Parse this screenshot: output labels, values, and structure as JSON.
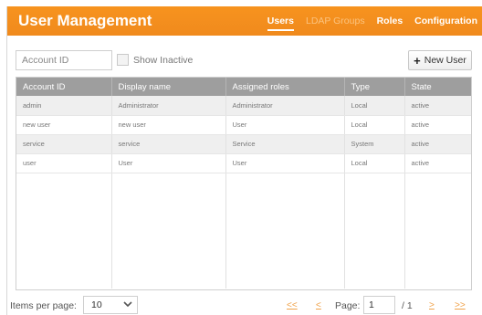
{
  "header": {
    "title": "User Management",
    "tabs": [
      {
        "label": "Users",
        "state": "active"
      },
      {
        "label": "LDAP Groups",
        "state": "dim"
      },
      {
        "label": "Roles",
        "state": "normal"
      },
      {
        "label": "Configuration",
        "state": "normal"
      }
    ]
  },
  "toolbar": {
    "search_placeholder": "Account ID",
    "show_inactive_label": "Show Inactive",
    "new_user_label": "New User"
  },
  "table": {
    "columns": [
      "Account ID",
      "Display name",
      "Assigned roles",
      "Type",
      "State"
    ],
    "rows": [
      [
        "admin",
        "Administrator",
        "Administrator",
        "Local",
        "active"
      ],
      [
        "new user",
        "new user",
        "User",
        "Local",
        "active"
      ],
      [
        "service",
        "service",
        "Service",
        "System",
        "active"
      ],
      [
        "user",
        "User",
        "User",
        "Local",
        "active"
      ]
    ]
  },
  "footer": {
    "items_per_page_label": "Items per page:",
    "items_per_page_value": "10",
    "first": "<<",
    "prev": "<",
    "page_label": "Page:",
    "page_value": "1",
    "page_total": "/ 1",
    "next": ">",
    "last": ">>"
  },
  "colors": {
    "header_bg": "#f7931e",
    "table_header_bg": "#9e9e9e",
    "pager_link": "#f0a24a"
  }
}
